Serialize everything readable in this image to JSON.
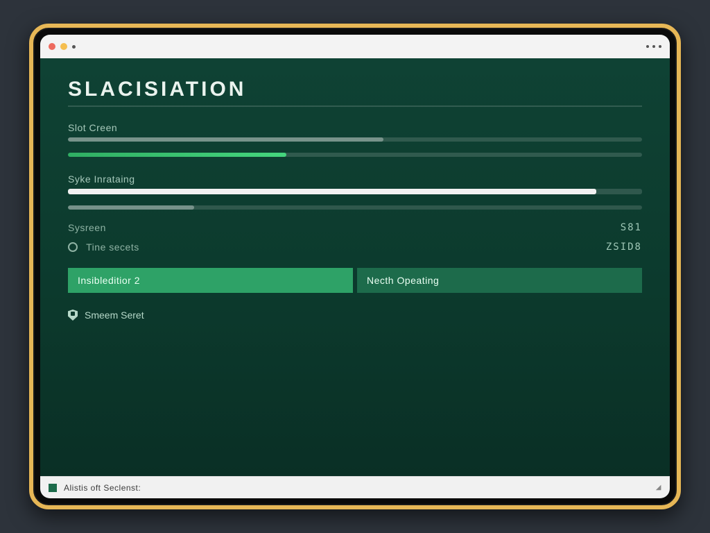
{
  "window": {
    "title": "SLACISIATION"
  },
  "progress": {
    "section1_label": "Slot Creen",
    "section1_fill_pct": 38,
    "section2_label": "Syke Inrataing",
    "section2_fill_pct": 92,
    "section3_fill_pct": 22
  },
  "stats": {
    "row1_label": "Sysreen",
    "row1_value": "S81",
    "row2_label": "Tine secets",
    "row2_value": "ZSID8"
  },
  "buttons": {
    "left_label": "Insibleditior 2",
    "right_label": "Necth Opeating"
  },
  "link": {
    "label": "Smeem Seret"
  },
  "statusbar": {
    "text": "Alistis oft Seclenst:"
  }
}
